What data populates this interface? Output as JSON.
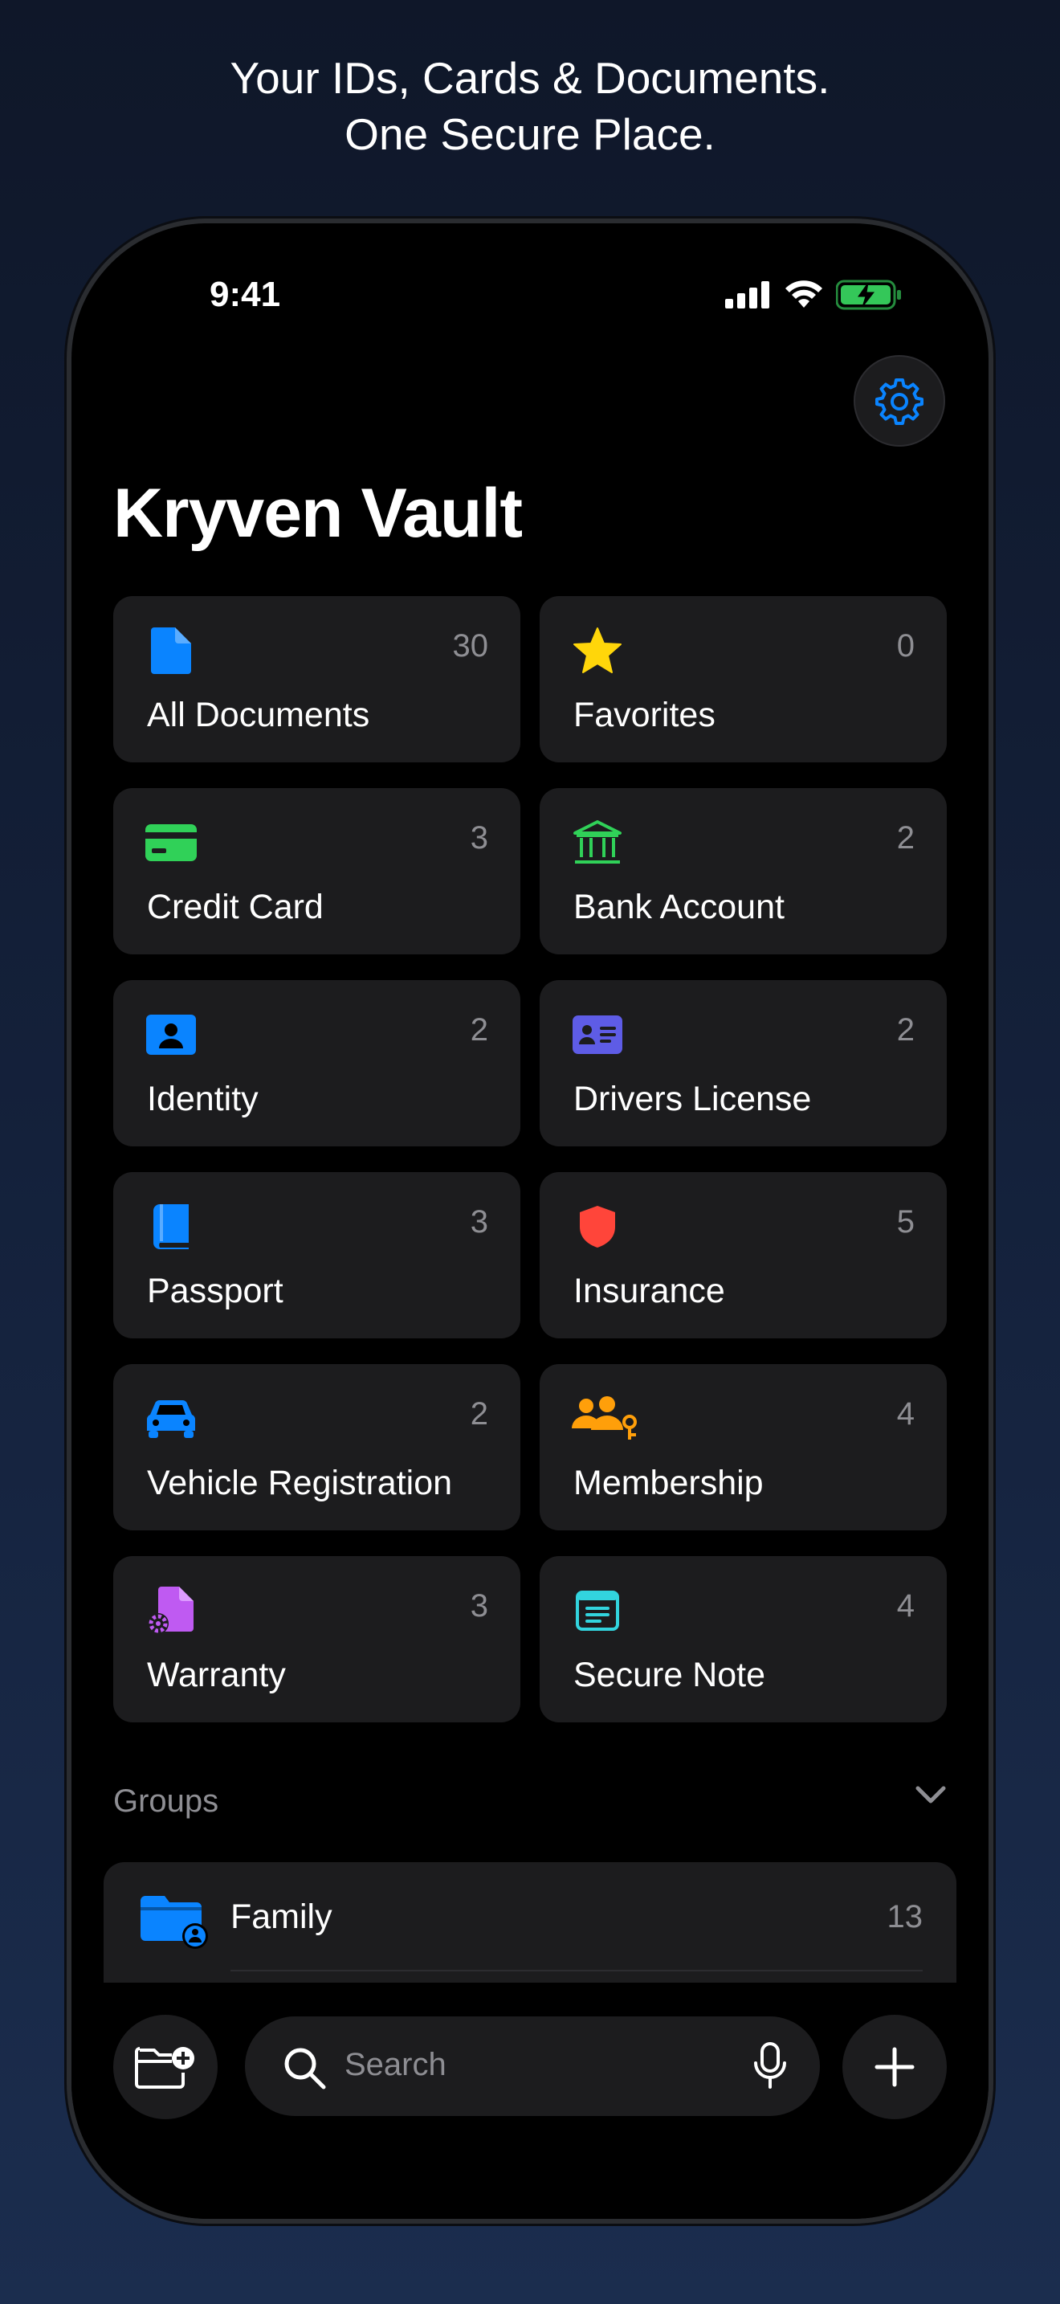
{
  "headline": {
    "line1": "Your IDs, Cards & Documents.",
    "line2": "One Secure Place."
  },
  "status_bar": {
    "time": "9:41",
    "icons": [
      "signal-icon",
      "wifi-icon",
      "battery-charging-icon"
    ]
  },
  "app": {
    "title": "Kryven Vault",
    "settings_icon": "gear-icon"
  },
  "categories": [
    {
      "label": "All Documents",
      "count": "30",
      "icon": "document-icon",
      "color": "#0a84ff"
    },
    {
      "label": "Favorites",
      "count": "0",
      "icon": "star-icon",
      "color": "#ffd60a"
    },
    {
      "label": "Credit Card",
      "count": "3",
      "icon": "credit-card-icon",
      "color": "#30d158"
    },
    {
      "label": "Bank Account",
      "count": "2",
      "icon": "bank-icon",
      "color": "#30d158"
    },
    {
      "label": "Identity",
      "count": "2",
      "icon": "person-badge-icon",
      "color": "#0a84ff"
    },
    {
      "label": "Drivers License",
      "count": "2",
      "icon": "id-card-icon",
      "color": "#5e5ce6"
    },
    {
      "label": "Passport",
      "count": "3",
      "icon": "passport-book-icon",
      "color": "#0a84ff"
    },
    {
      "label": "Insurance",
      "count": "5",
      "icon": "shield-icon",
      "color": "#ff453a"
    },
    {
      "label": "Vehicle Registration",
      "count": "2",
      "icon": "car-icon",
      "color": "#0a84ff"
    },
    {
      "label": "Membership",
      "count": "4",
      "icon": "people-key-icon",
      "color": "#ff9f0a"
    },
    {
      "label": "Warranty",
      "count": "3",
      "icon": "document-gear-icon",
      "color": "#bf5af2"
    },
    {
      "label": "Secure Note",
      "count": "4",
      "icon": "note-icon",
      "color": "#32d4de"
    }
  ],
  "groups": {
    "label": "Groups",
    "items": [
      {
        "name": "Family",
        "count": "13",
        "icon": "folder-person-icon"
      }
    ]
  },
  "bottom_bar": {
    "new_folder_icon": "folder-add-icon",
    "search_placeholder": "Search",
    "mic_icon": "microphone-icon",
    "add_icon": "plus-icon"
  }
}
